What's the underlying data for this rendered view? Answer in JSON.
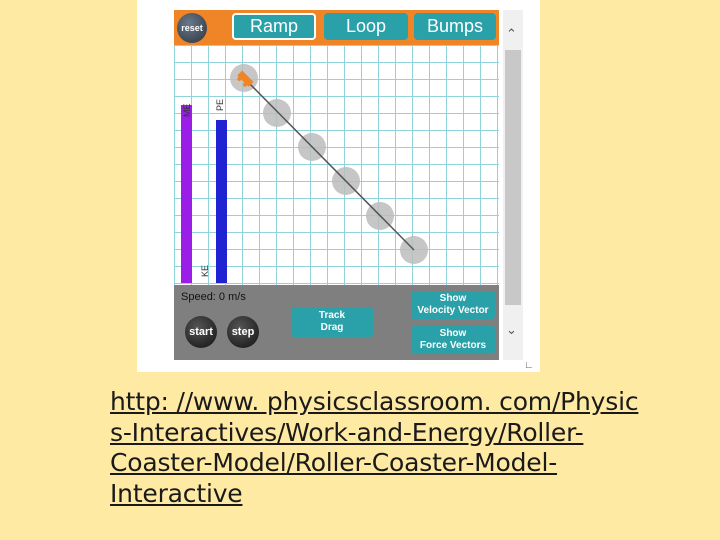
{
  "simulation": {
    "reset_label": "reset",
    "tabs": [
      {
        "label": "Ramp",
        "selected": true
      },
      {
        "label": "Loop",
        "selected": false
      },
      {
        "label": "Bumps",
        "selected": false
      }
    ],
    "energy_bars": [
      {
        "label": "ME",
        "color": "#9b1ee8"
      },
      {
        "label": "PE",
        "color": "#1f23d2"
      },
      {
        "label": "KE",
        "color": "#1f23d2"
      }
    ],
    "speed_text": "Speed: 0 m/s",
    "start_label": "start",
    "step_label": "step",
    "track_drag": [
      "Track",
      "Drag"
    ],
    "show_velocity": [
      "Show",
      "Velocity Vector"
    ],
    "show_force": [
      "Show",
      "Force Vectors"
    ]
  },
  "caption": {
    "lines": [
      "http: //www. physicsclassroom. com/Physic",
      "s-Interactives/Work-and-Energy/Roller-",
      "Coaster-Model/Roller-Coaster-Model-",
      "Interactive"
    ]
  }
}
